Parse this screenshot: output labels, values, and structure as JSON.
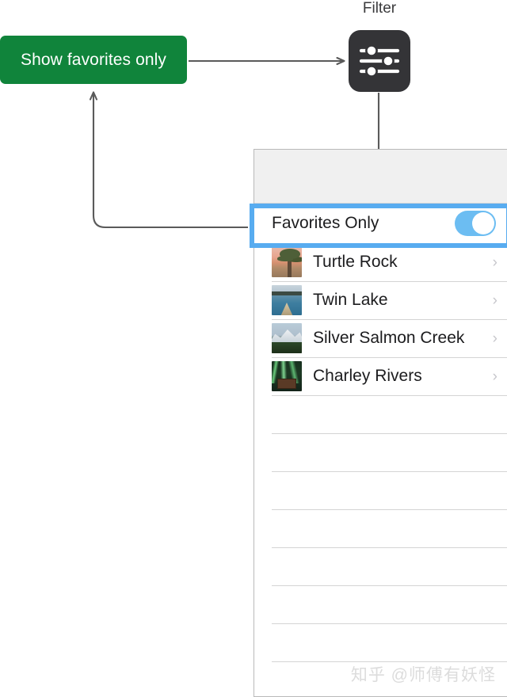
{
  "annotations": {
    "green_label": "Show favorites only",
    "filter_caption": "Filter",
    "green_color": "#10843B",
    "arrow_color": "#5a5a5a",
    "highlight_color": "#58ACF0"
  },
  "filter_icon": {
    "name": "slider-horizontal-3-icon",
    "background": "#343437",
    "rows": [
      {
        "knob_percent": 28
      },
      {
        "knob_percent": 66
      },
      {
        "knob_percent": 28
      }
    ]
  },
  "panel": {
    "toggle_row": {
      "label": "Favorites Only",
      "switch_on": true,
      "switch_color": "#6CBDF2"
    },
    "list_items": [
      {
        "name": "Turtle Rock",
        "thumb": "turtle-rock-thumbnail",
        "chevron": "›"
      },
      {
        "name": "Twin Lake",
        "thumb": "twin-lake-thumbnail",
        "chevron": "›"
      },
      {
        "name": "Silver Salmon Creek",
        "thumb": "silver-salmon-creek-thumbnail",
        "chevron": "›"
      },
      {
        "name": "Charley Rivers",
        "thumb": "charley-rivers-thumbnail",
        "chevron": "›"
      }
    ],
    "empty_row_count": 8
  },
  "watermark": "知乎 @师傅有妖怪"
}
